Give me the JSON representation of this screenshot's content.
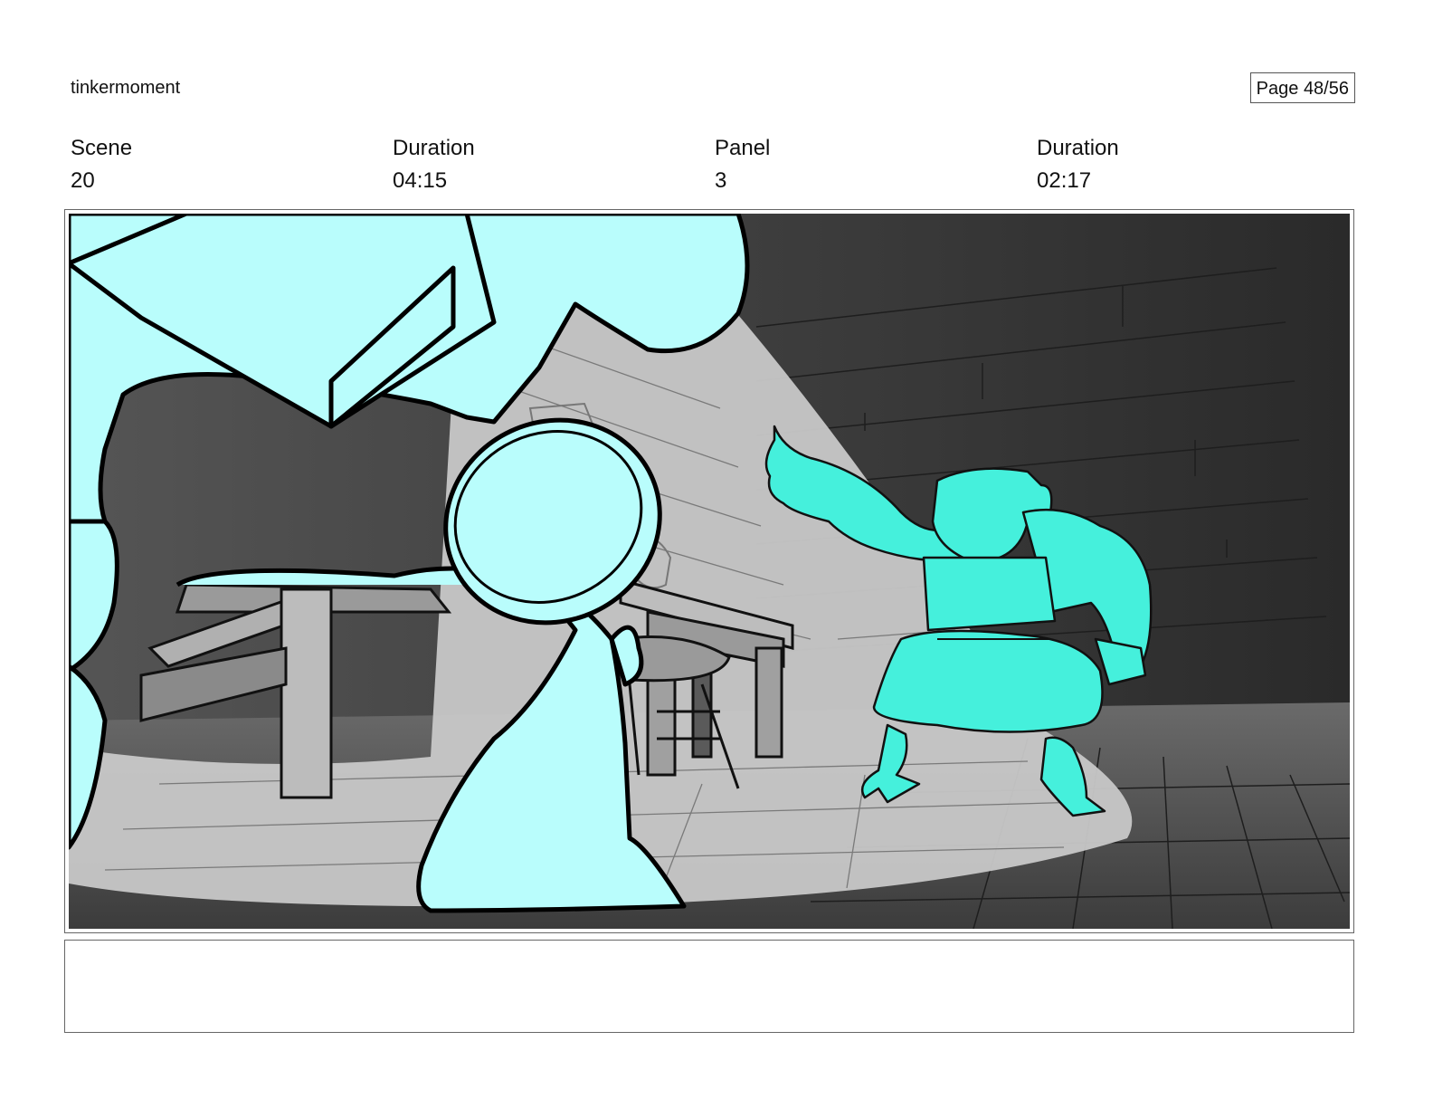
{
  "header": {
    "project": "tinkermoment",
    "page": "Page 48/56"
  },
  "meta": {
    "scene_label": "Scene",
    "scene_value": "20",
    "scene_duration_label": "Duration",
    "scene_duration_value": "04:15",
    "panel_label": "Panel",
    "panel_value": "3",
    "panel_duration_label": "Duration",
    "panel_duration_value": "02:17"
  },
  "notes": {
    "text": ""
  },
  "colors": {
    "foreground_character": "#b9fdfc",
    "background_character": "#45f0dc",
    "background_dark": "#3a3a3a",
    "spotlight": "#c9c9c9"
  }
}
